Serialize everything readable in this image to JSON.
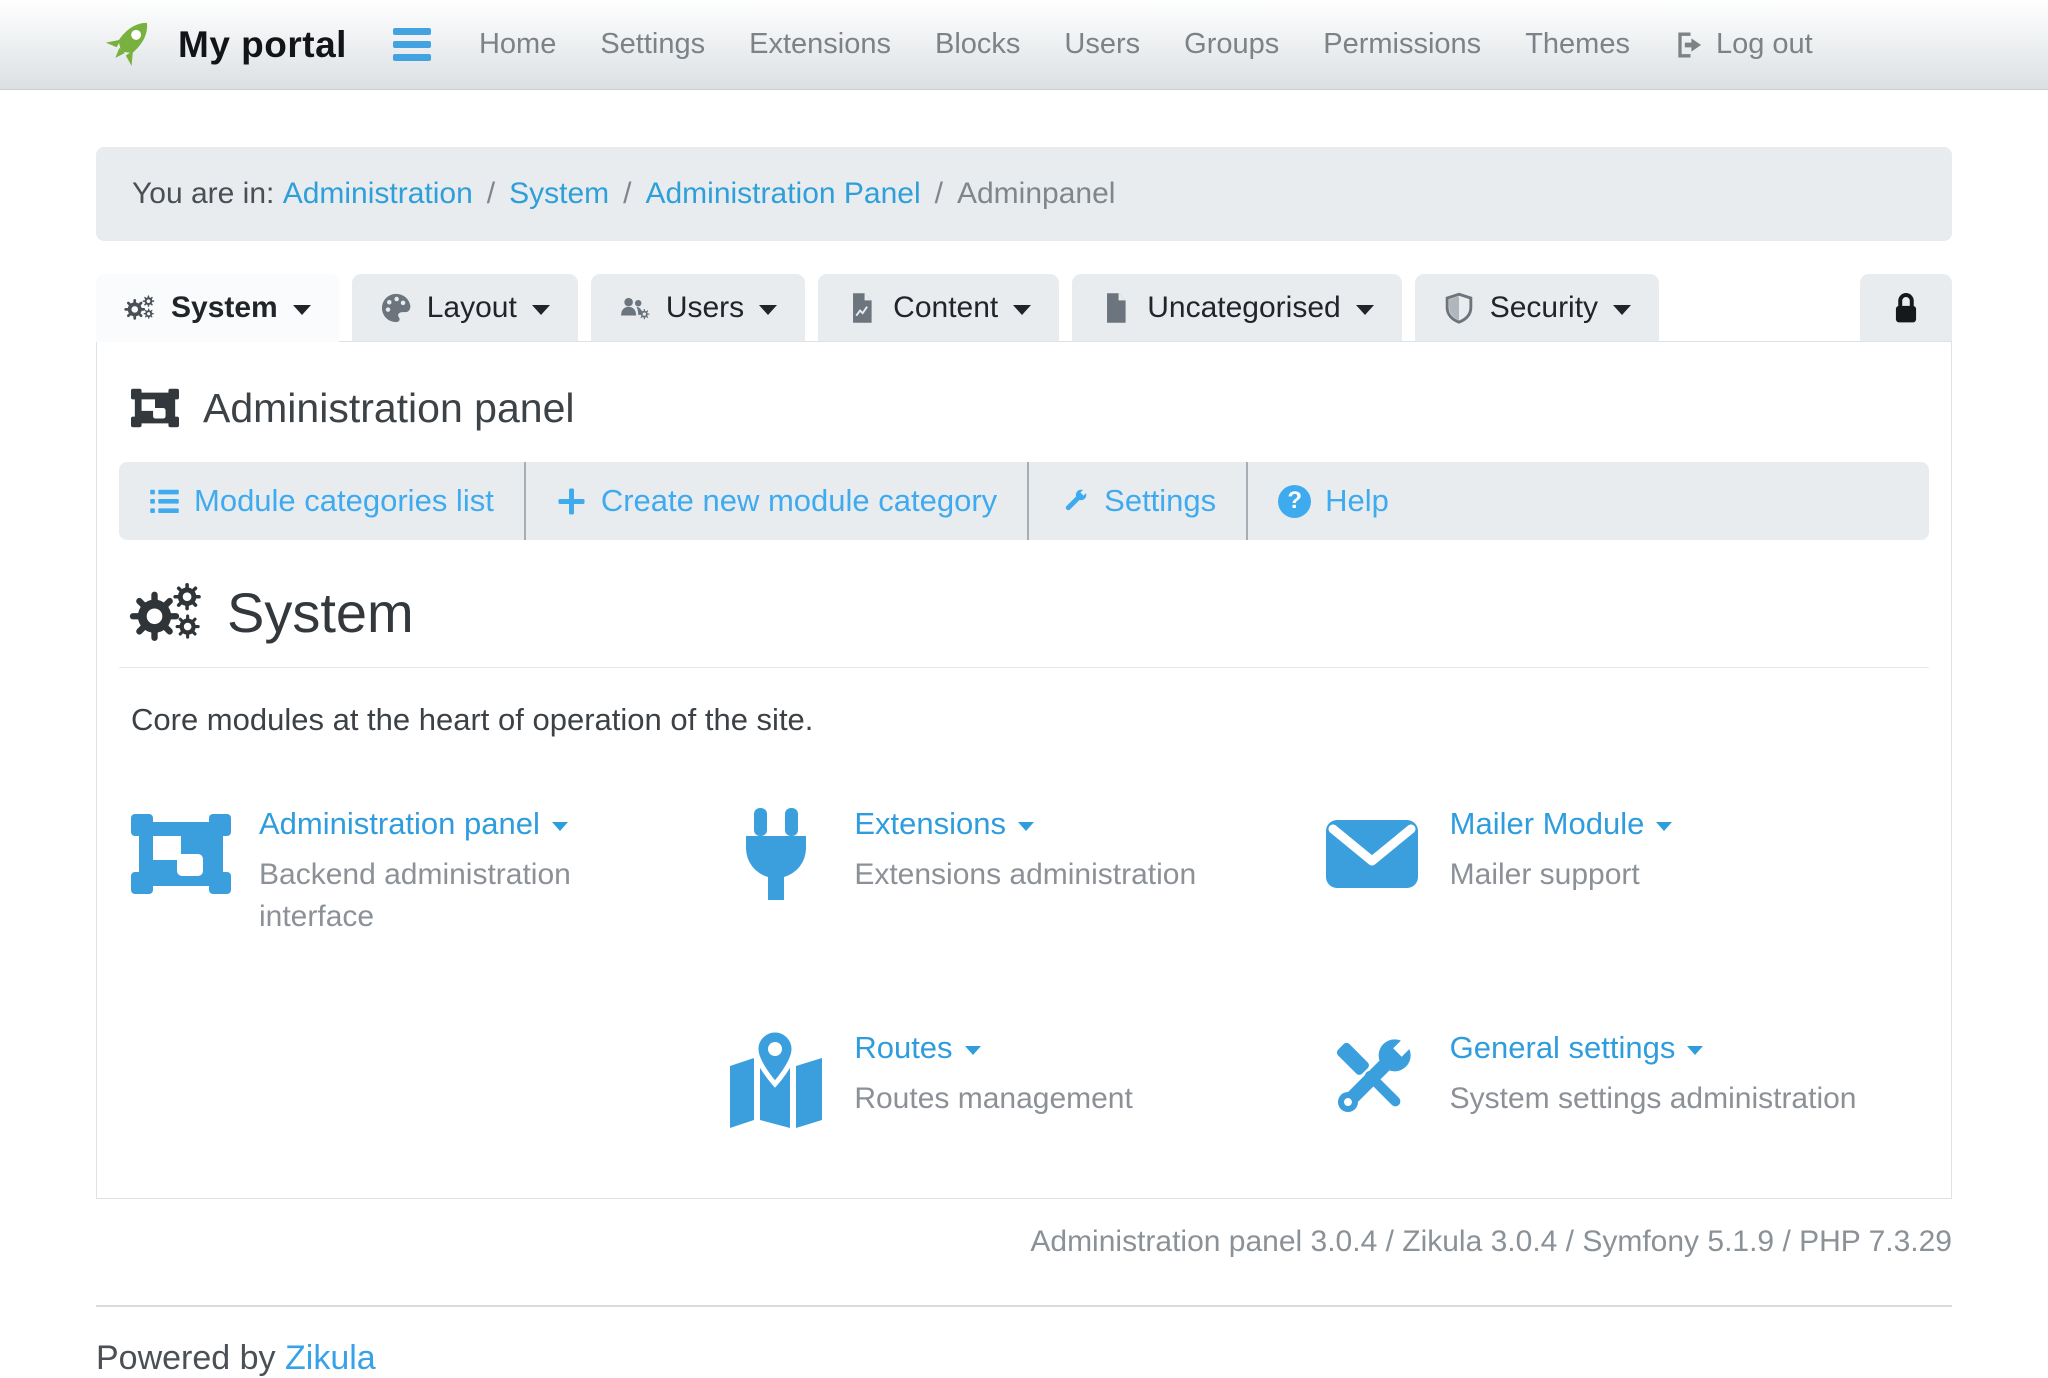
{
  "navbar": {
    "brand": "My portal",
    "items": [
      {
        "label": "Home"
      },
      {
        "label": "Settings"
      },
      {
        "label": "Extensions"
      },
      {
        "label": "Blocks"
      },
      {
        "label": "Users"
      },
      {
        "label": "Groups"
      },
      {
        "label": "Permissions"
      },
      {
        "label": "Themes"
      },
      {
        "label": "Log out",
        "icon": "sign-out-icon"
      }
    ]
  },
  "breadcrumb": {
    "prefix": "You are in:",
    "sep": "/",
    "links": [
      {
        "label": "Administration"
      },
      {
        "label": "System"
      },
      {
        "label": "Administration Panel"
      }
    ],
    "current": "Adminpanel"
  },
  "tabs": [
    {
      "label": "System",
      "icon": "cogs-icon",
      "active": true
    },
    {
      "label": "Layout",
      "icon": "palette-icon",
      "active": false
    },
    {
      "label": "Users",
      "icon": "users-cog-icon",
      "active": false
    },
    {
      "label": "Content",
      "icon": "file-chart-icon",
      "active": false
    },
    {
      "label": "Uncategorised",
      "icon": "file-icon",
      "active": false
    },
    {
      "label": "Security",
      "icon": "shield-icon",
      "active": false
    }
  ],
  "lock_tab": {
    "icon": "lock-icon"
  },
  "panel": {
    "title": "Administration panel",
    "toolbar": [
      {
        "label": "Module categories list",
        "icon": "list-icon"
      },
      {
        "label": "Create new module category",
        "icon": "plus-icon"
      },
      {
        "label": "Settings",
        "icon": "wrench-icon"
      },
      {
        "label": "Help",
        "icon": "question-circle-icon"
      }
    ],
    "section": {
      "title": "System",
      "description": "Core modules at the heart of operation of the site."
    },
    "modules": [
      {
        "title": "Administration panel",
        "description": "Backend administration interface",
        "icon": "object-group-icon"
      },
      {
        "title": "Extensions",
        "description": "Extensions administration",
        "icon": "plug-icon"
      },
      {
        "title": "Mailer Module",
        "description": "Mailer support",
        "icon": "envelope-icon"
      },
      {
        "title": "Routes",
        "description": "Routes management",
        "icon": "map-marked-icon"
      },
      {
        "title": "General settings",
        "description": "System settings administration",
        "icon": "tools-icon"
      }
    ]
  },
  "footer": {
    "versions": "Administration panel 3.0.4 / Zikula 3.0.4 / Symfony 5.1.9 / PHP 7.3.29",
    "powered_prefix": "Powered by",
    "powered_link": "Zikula"
  },
  "colors": {
    "link_blue": "#2e9fd9",
    "toolbar_blue": "#3fabef",
    "module_icon_blue": "#3b9fdd",
    "logo_green": "#79b13f",
    "tab_bg": "#e9ecef",
    "panel_border": "#dee2e6"
  }
}
